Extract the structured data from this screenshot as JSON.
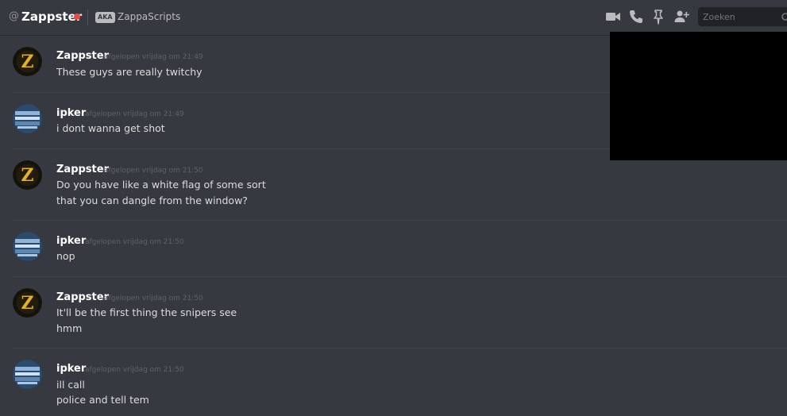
{
  "header": {
    "at_symbol": "@",
    "channel_name": "Zappster",
    "status_color": "#f04747",
    "aka_label": "AKA",
    "aka_name": "ZappaScripts",
    "icons": [
      "video-call-icon",
      "voice-call-icon",
      "pin-icon",
      "add-friend-icon"
    ],
    "search_placeholder": "Zoeken"
  },
  "messages": [
    {
      "author": "Zappster",
      "avatar": "z-logo-avatar",
      "timestamp": "afgelopen vrijdag om 21:49",
      "lines": [
        "These guys are really twitchy"
      ]
    },
    {
      "author": "ipker",
      "avatar": "blue-avatar",
      "timestamp": "afgelopen vrijdag om 21:49",
      "lines": [
        "i dont wanna get shot"
      ]
    },
    {
      "author": "Zappster",
      "avatar": "z-logo-avatar",
      "timestamp": "afgelopen vrijdag om 21:50",
      "lines": [
        "Do you have like a white flag of some sort",
        "that you can dangle from the window?"
      ]
    },
    {
      "author": "ipker",
      "avatar": "blue-avatar",
      "timestamp": "afgelopen vrijdag om 21:50",
      "lines": [
        "nop"
      ]
    },
    {
      "author": "Zappster",
      "avatar": "z-logo-avatar",
      "timestamp": "afgelopen vrijdag om 21:50",
      "lines": [
        "It'll be the first thing the snipers see",
        "hmm"
      ]
    },
    {
      "author": "ipker",
      "avatar": "blue-avatar",
      "timestamp": "afgelopen vrijdag om 21:50",
      "lines": [
        "ill call",
        "police and tell tem"
      ]
    }
  ]
}
